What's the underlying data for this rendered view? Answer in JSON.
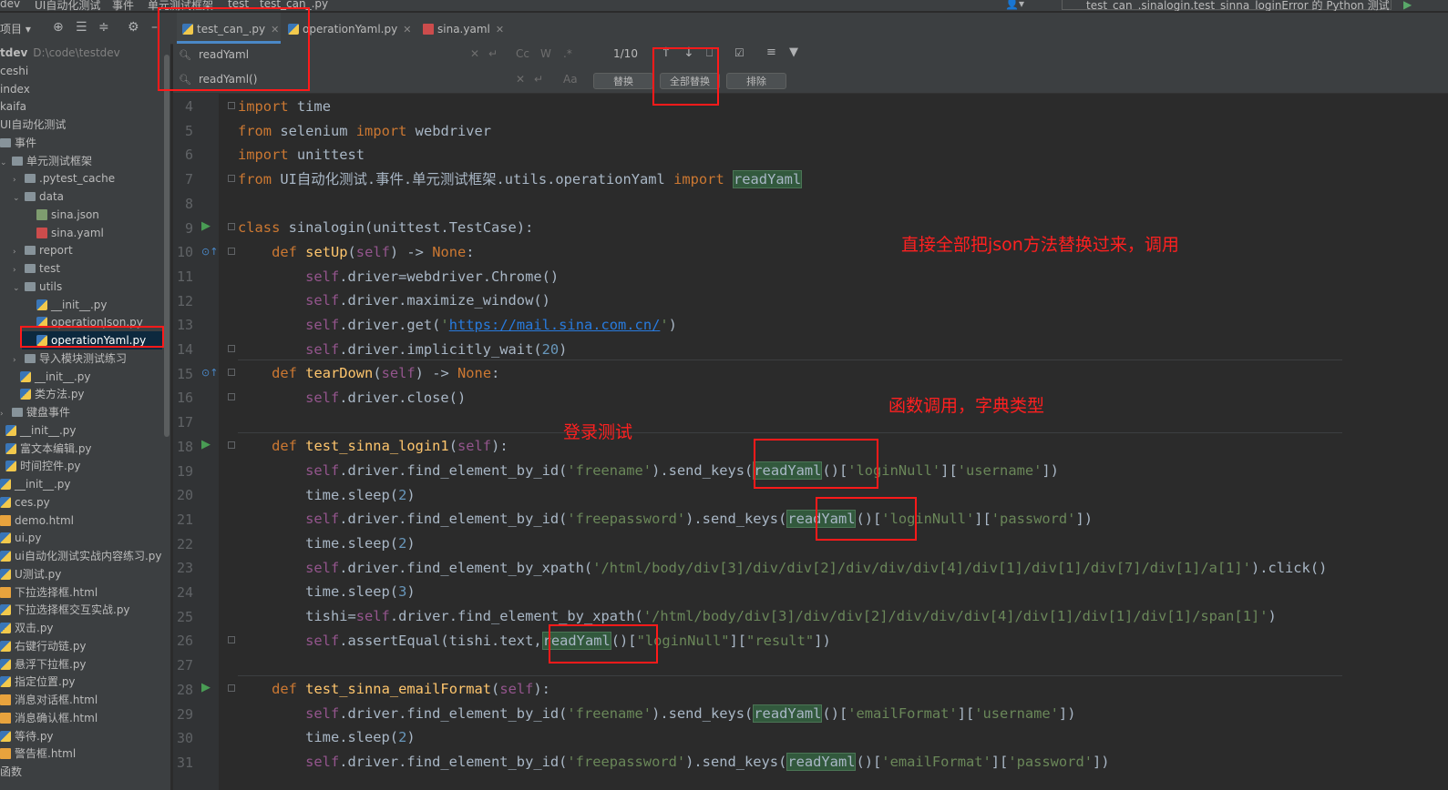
{
  "breadcrumb": [
    "dev",
    "UI自动化测试",
    "事件",
    "单元测试框架",
    "test",
    "test_can_.py"
  ],
  "run_config": "test_can_.sinalogin.test_sinna_loginError 的 Python 测试",
  "project_label": "项目",
  "tree": [
    {
      "label": "tdev",
      "extra": "D:\\code\\testdev",
      "type": "root"
    },
    {
      "label": "ceshi"
    },
    {
      "label": "index"
    },
    {
      "label": "kaifa"
    },
    {
      "label": "UI自动化测试"
    },
    {
      "label": "事件"
    },
    {
      "label": "单元测试框架"
    },
    {
      "label": ".pytest_cache"
    },
    {
      "label": "data"
    },
    {
      "label": "sina.json"
    },
    {
      "label": "sina.yaml"
    },
    {
      "label": "report"
    },
    {
      "label": "test"
    },
    {
      "label": "utils"
    },
    {
      "label": "__init__.py"
    },
    {
      "label": "operationJson.py"
    },
    {
      "label": "operationYaml.py"
    },
    {
      "label": "导入模块测试练习"
    },
    {
      "label": "__init__.py"
    },
    {
      "label": "类方法.py"
    },
    {
      "label": "键盘事件"
    },
    {
      "label": "__init__.py"
    },
    {
      "label": "富文本编辑.py"
    },
    {
      "label": "时间控件.py"
    },
    {
      "label": "__init__.py"
    },
    {
      "label": "ces.py"
    },
    {
      "label": "demo.html"
    },
    {
      "label": "ui.py"
    },
    {
      "label": "ui自动化测试实战内容练习.py"
    },
    {
      "label": "U测试.py"
    },
    {
      "label": "下拉选择框.html"
    },
    {
      "label": "下拉选择框交互实战.py"
    },
    {
      "label": "双击.py"
    },
    {
      "label": "右键行动链.py"
    },
    {
      "label": "悬浮下拉框.py"
    },
    {
      "label": "指定位置.py"
    },
    {
      "label": "消息对话框.html"
    },
    {
      "label": "消息确认框.html"
    },
    {
      "label": "等待.py"
    },
    {
      "label": "警告框.html"
    },
    {
      "label": "函数"
    }
  ],
  "tabs": [
    {
      "label": "test_can_.py"
    },
    {
      "label": "operationYaml.py"
    },
    {
      "label": "sina.yaml"
    }
  ],
  "find": {
    "search_value": "readYaml",
    "replace_value": "readYaml()",
    "match_count": "1/10",
    "opt_case": "Cc",
    "opt_word": "W",
    "opt_regex": ".*",
    "replace_btn": "替换",
    "replace_all_btn": "全部替换",
    "exclude_btn": "排除"
  },
  "line_numbers": [
    "4",
    "5",
    "6",
    "7",
    "8",
    "9",
    "10",
    "11",
    "12",
    "13",
    "14",
    "15",
    "16",
    "17",
    "18",
    "19",
    "20",
    "21",
    "22",
    "23",
    "24",
    "25",
    "26",
    "27",
    "28",
    "29",
    "30",
    "31"
  ],
  "code": {
    "l5_mod": "selenium",
    "l5_name": "webdriver",
    "l6_mod": "unittest",
    "l7_mod": "UI自动化测试.事件.单元测试框架.utils.operationYaml",
    "l7_name": "readYaml",
    "l9_cls": "sinalogin",
    "l9_base": "(unittest.TestCase):",
    "l11_rest": ".driver=webdriver.Chrome()",
    "l12_rest": ".driver.maximize_window()",
    "l13_pre": ".driver.get(",
    "l13_url": "https://mail.sina.com.cn/",
    "l14_pre": ".driver.implicitly_wait(",
    "l14_num": "20",
    "l16_rest": ".driver.close()",
    "l19_pre": ".driver.find_element_by_id(",
    "l19_arg": "'freename'",
    "l19_mid": ").send_keys(",
    "l19_k1": "'loginNull'",
    "l19_k2": "'username'",
    "sleep2": "time.sleep(",
    "n2": "2",
    "n3": "3",
    "l21_arg": "'freepassword'",
    "l21_k2": "'password'",
    "l23_pre": ".driver.find_element_by_xpath(",
    "l23_arg": "'/html/body/div[3]/div/div[2]/div/div/div[4]/div[1]/div[1]/div[7]/div[1]/a[1]'",
    "l23_post": ").click()",
    "l25_pre": "tishi=",
    "l25_arg": "'/html/body/div[3]/div/div[2]/div/div/div[4]/div[1]/div[1]/div[1]/span[1]'",
    "l26_pre": ".assertEqual(tishi.text,",
    "l26_k1": "\"loginNull\"",
    "l26_k2": "\"result\"",
    "l29_k1": "'emailFormat'",
    "fn_setup": "setUp",
    "fn_teardown": "tearDown",
    "fn_login1": "test_sinna_login1",
    "fn_email": "test_sinna_emailFormat",
    "kw_import": "import",
    "kw_from": "from",
    "kw_class": "class",
    "kw_def": "def",
    "kw_none": "None",
    "mod_time": "time",
    "self": "self",
    "readyaml": "readYaml"
  },
  "annotations": {
    "note1": "直接全部把json方法替换过来，调用",
    "note2": "函数调用，字典类型",
    "note3": "登录测试"
  },
  "colors": {
    "accent": "#4a88c7",
    "annotation": "#ff2020",
    "highlight": "#32593d"
  }
}
